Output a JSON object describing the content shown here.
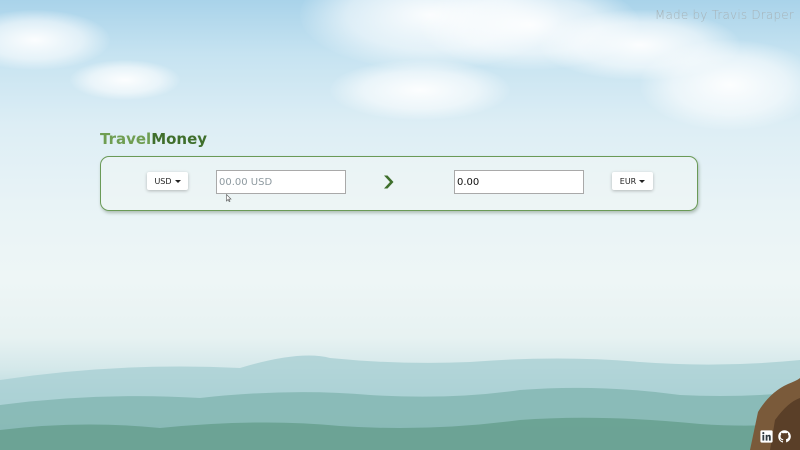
{
  "credit": "Made by Travis Draper",
  "brand": {
    "part1": "Travel",
    "part2": "Money"
  },
  "converter": {
    "from_currency": "USD",
    "from_placeholder": "00.00 USD",
    "to_value": "0.00",
    "to_currency": "EUR"
  },
  "icons": {
    "convert": "chevron-right-icon",
    "linkedin": "linkedin-icon",
    "github": "github-icon"
  },
  "colors": {
    "brand_light": "#6f9e52",
    "brand_dark": "#3f6f2c",
    "panel_border": "#6a9a57"
  }
}
